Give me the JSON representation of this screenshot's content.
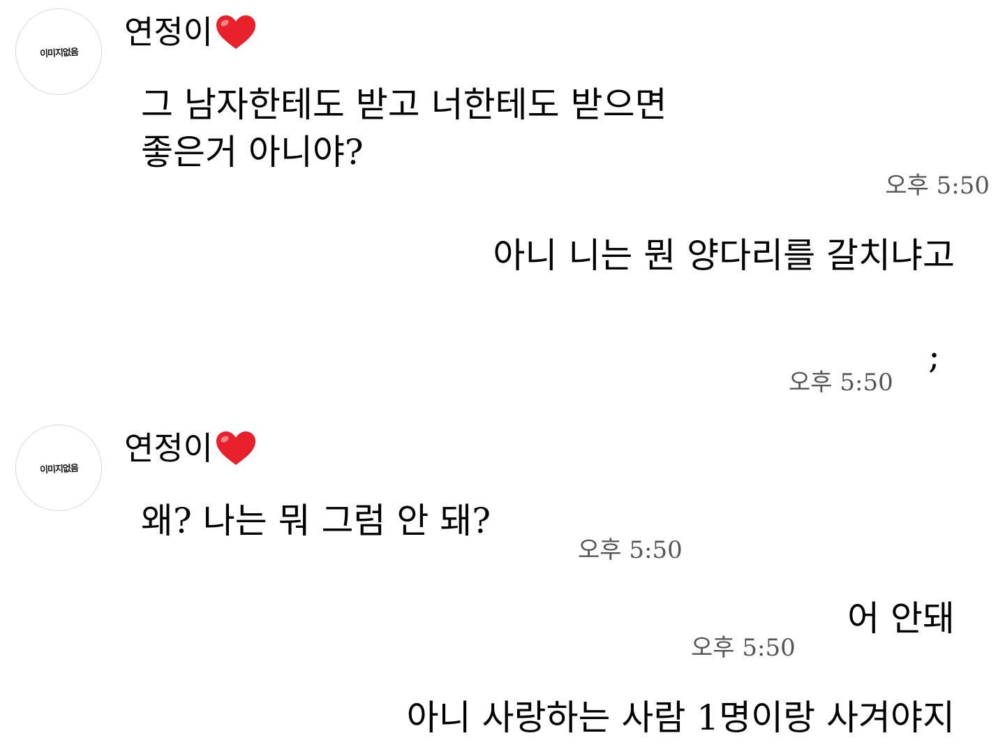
{
  "contact": {
    "name": "연정이",
    "avatar_text": "이미지없음",
    "heart_icon": "red-heart-icon",
    "heart_color": "#e8202a"
  },
  "messages": [
    {
      "from": "contact",
      "lines": [
        "그 남자한테도 받고 너한테도 받으면",
        "좋은거 아니야?"
      ],
      "time": "오후 5:50"
    },
    {
      "from": "me",
      "lines": [
        "아니 니는 뭔 양다리를 갈치냐고"
      ]
    },
    {
      "from": "me",
      "lines": [
        ";"
      ],
      "time": "오후 5:50"
    },
    {
      "from": "contact",
      "lines": [
        "왜? 나는 뭐 그럼 안 돼?"
      ],
      "time": "오후 5:50"
    },
    {
      "from": "me",
      "lines": [
        "어 안돼"
      ],
      "time": "오후 5:50"
    },
    {
      "from": "me",
      "lines": [
        "아니 사랑하는 사람 1명이랑 사겨야지"
      ]
    }
  ]
}
